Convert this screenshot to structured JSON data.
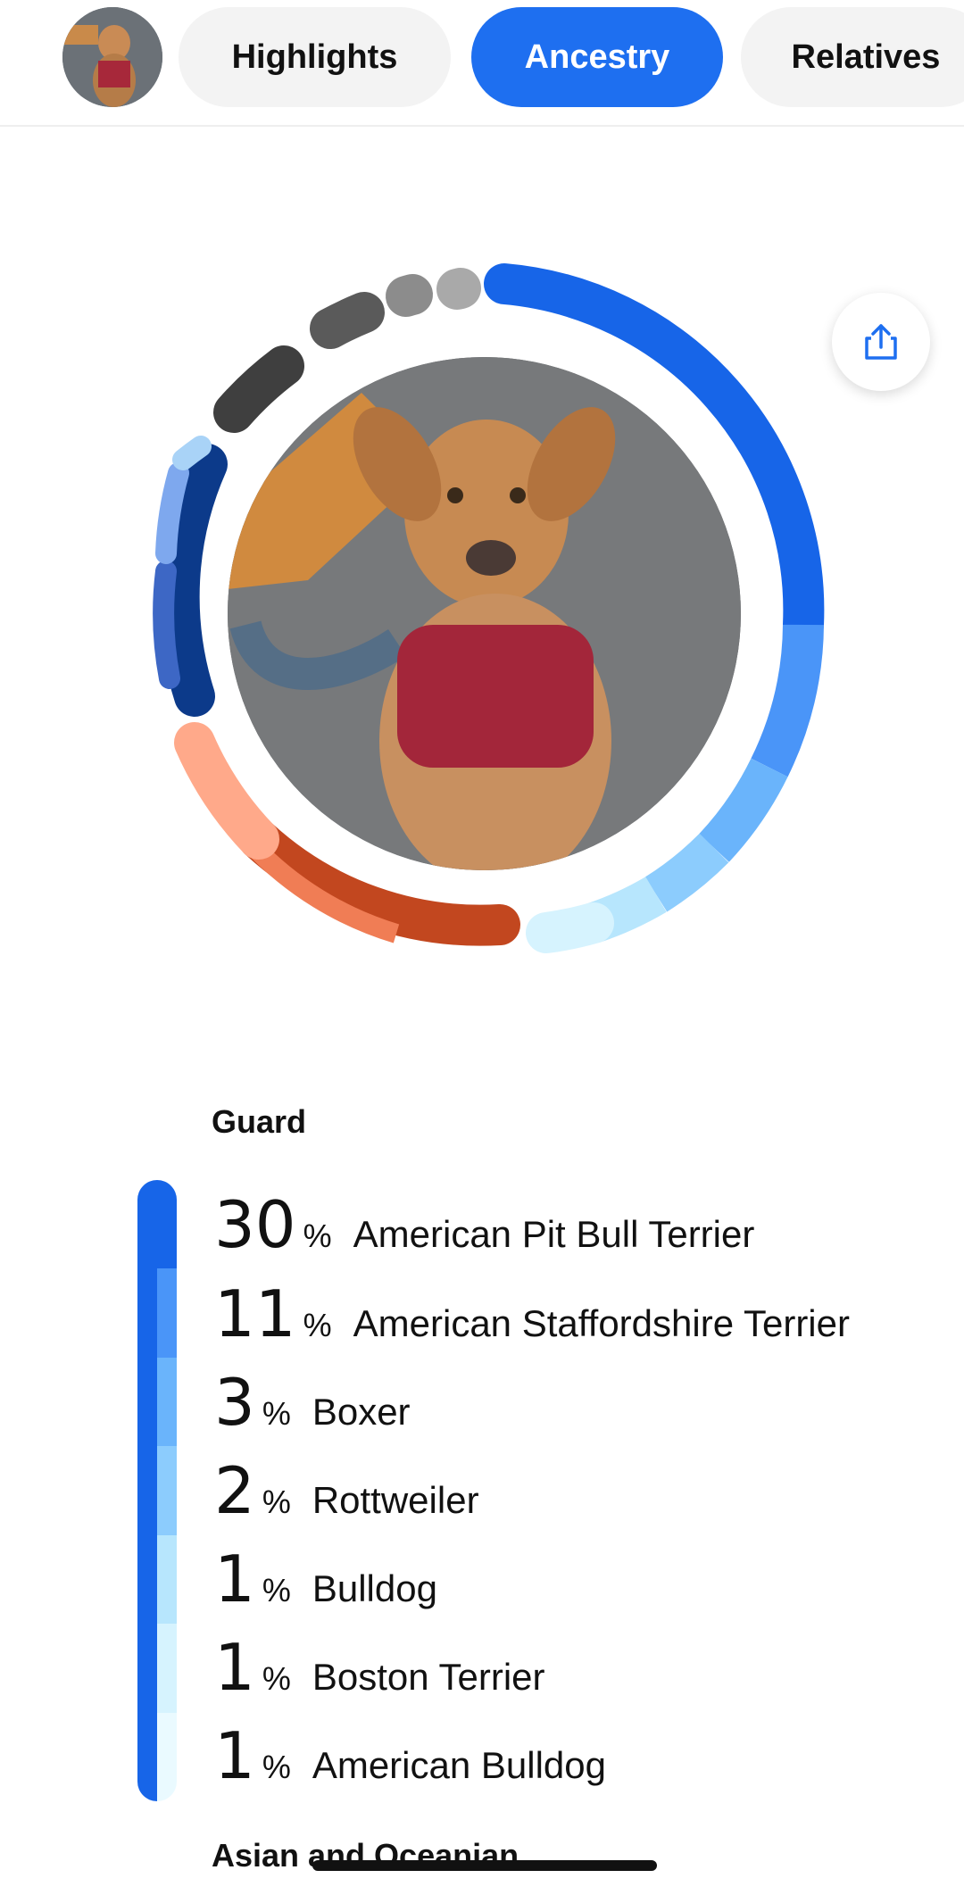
{
  "tabs": [
    {
      "label": "Highlights",
      "active": false
    },
    {
      "label": "Ancestry",
      "active": true
    },
    {
      "label": "Relatives",
      "active": false
    }
  ],
  "colors": {
    "accent": "#1e6ff0",
    "guard_segments": [
      "#1765e8",
      "#4a95f8",
      "#6ab4fb",
      "#8cccfd",
      "#b7e6fd",
      "#d6f3fe",
      "#eafaff"
    ],
    "terrier_segments": [
      "#0c3a8a",
      "#3d67c5",
      "#7ea8ee",
      "#a9d3f7"
    ],
    "asian_segments": [
      "#c2471f",
      "#f07d55",
      "#ffa98a",
      "#ffd6c2"
    ],
    "other_segments": [
      "#4a4a4a",
      "#7a7a7a",
      "#9b9b9b",
      "#b5b5b5"
    ]
  },
  "icons": {
    "share": "share-upload-icon"
  },
  "sections": [
    {
      "title": "Guard",
      "breeds": [
        {
          "percent": "30",
          "name": "American Pit Bull Terrier"
        },
        {
          "percent": "11",
          "name": "American Staffordshire Terrier"
        },
        {
          "percent": "3",
          "name": "Boxer"
        },
        {
          "percent": "2",
          "name": "Rottweiler"
        },
        {
          "percent": "1",
          "name": "Bulldog"
        },
        {
          "percent": "1",
          "name": "Boston Terrier"
        },
        {
          "percent": "1",
          "name": "American Bulldog"
        }
      ]
    },
    {
      "title": "Asian and Oceanian"
    }
  ],
  "percent_sign": "%"
}
